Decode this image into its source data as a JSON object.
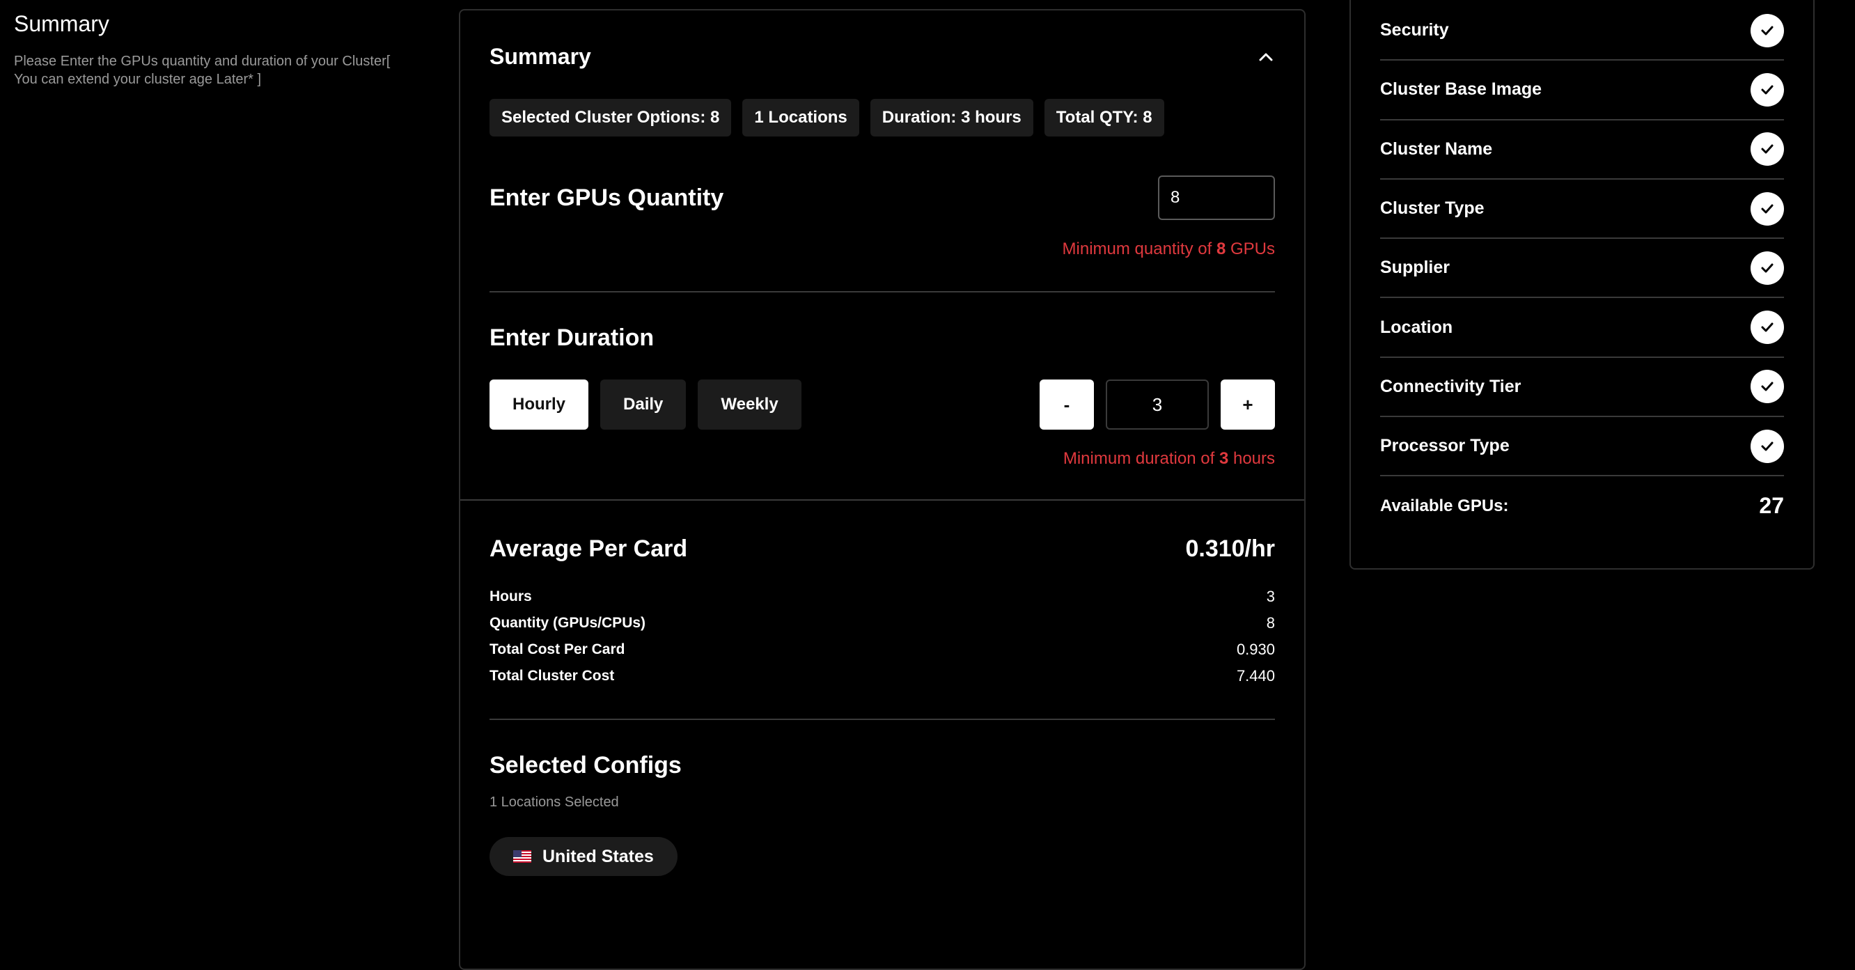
{
  "left": {
    "title": "Summary",
    "description": "Please Enter the GPUs quantity and duration of your Cluster[ You can extend your cluster age Later* ]"
  },
  "summary": {
    "title": "Summary",
    "chips": [
      "Selected Cluster Options: 8",
      "1 Locations",
      "Duration: 3 hours",
      "Total QTY: 8"
    ]
  },
  "quantity": {
    "title": "Enter GPUs Quantity",
    "value": "8",
    "hint_prefix": "Minimum quantity of ",
    "hint_value": "8",
    "hint_suffix": " GPUs"
  },
  "duration": {
    "title": "Enter Duration",
    "options": [
      "Hourly",
      "Daily",
      "Weekly"
    ],
    "selected": "Hourly",
    "minus_label": "-",
    "plus_label": "+",
    "value": "3",
    "hint_prefix": "Minimum duration of ",
    "hint_value": "3",
    "hint_suffix": " hours"
  },
  "pricing": {
    "title": "Average Per Card",
    "value": "0.310/hr",
    "rows": [
      {
        "label": "Hours",
        "value": "3"
      },
      {
        "label": "Quantity (GPUs/CPUs)",
        "value": "8"
      },
      {
        "label": "Total Cost Per Card",
        "value": "0.930"
      },
      {
        "label": "Total Cluster Cost",
        "value": "7.440"
      }
    ]
  },
  "configs": {
    "title": "Selected Configs",
    "subtitle": "1 Locations Selected",
    "country": "United States"
  },
  "checklist": {
    "items": [
      "Security",
      "Cluster Base Image",
      "Cluster Name",
      "Cluster Type",
      "Supplier",
      "Location",
      "Connectivity Tier",
      "Processor Type"
    ],
    "available_label": "Available GPUs:",
    "available_value": "27"
  },
  "colors": {
    "accent_red": "#e0393e",
    "surface": "#1c1c1c",
    "border": "#2e2e2e"
  }
}
